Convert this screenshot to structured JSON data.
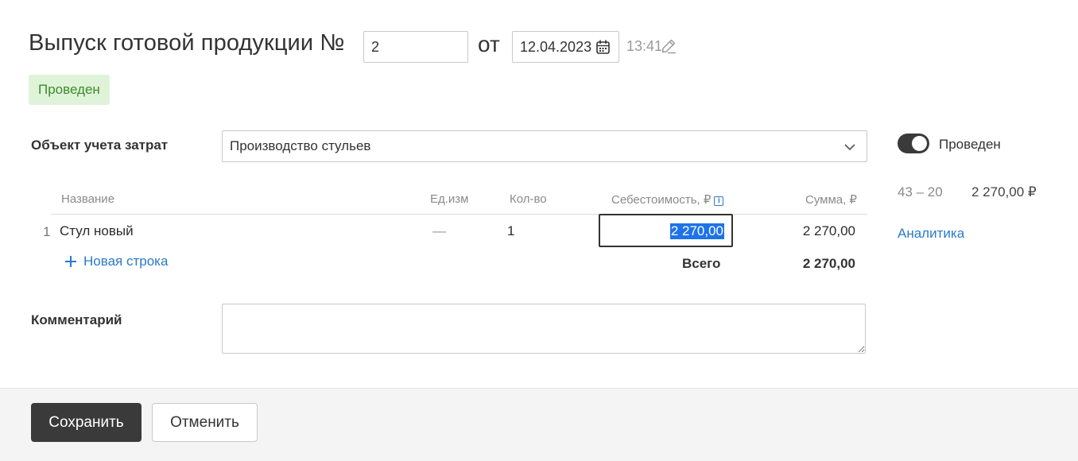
{
  "header": {
    "title": "Выпуск готовой продукции №",
    "number_value": "2",
    "from_label": "от",
    "date_value": "12.04.2023",
    "time_value": "13:41",
    "status_badge": "Проведен"
  },
  "form": {
    "cost_object_label": "Объект учета затрат",
    "cost_object_value": "Производство стульев",
    "comment_label": "Комментарий",
    "comment_value": ""
  },
  "table": {
    "columns": {
      "name": "Название",
      "unit": "Ед.изм",
      "qty": "Кол-во",
      "cost": "Себестоимость, ₽",
      "sum": "Сумма, ₽"
    },
    "rows": [
      {
        "index": "1",
        "name": "Стул новый",
        "unit": "—",
        "qty": "1",
        "cost": "2 270,00",
        "sum": "2 270,00"
      }
    ],
    "add_row_label": "Новая строка",
    "total_label": "Всего",
    "total_value": "2 270,00"
  },
  "side": {
    "posted_toggle_label": "Проведен",
    "posted_toggle_on": true,
    "account": "43 – 20",
    "account_sum": "2 270,00 ₽",
    "analytics_link": "Аналитика"
  },
  "footer": {
    "save_label": "Сохранить",
    "cancel_label": "Отменить"
  },
  "colors": {
    "accent": "#2a7ac8",
    "status_bg": "#dff3d9",
    "status_text": "#3f8a2c",
    "primary_button": "#3a3a3a",
    "selection": "#1e73e8"
  },
  "icons": [
    "calendar-icon",
    "pencil-icon",
    "chevron-down-icon",
    "info-icon",
    "plus-icon"
  ]
}
